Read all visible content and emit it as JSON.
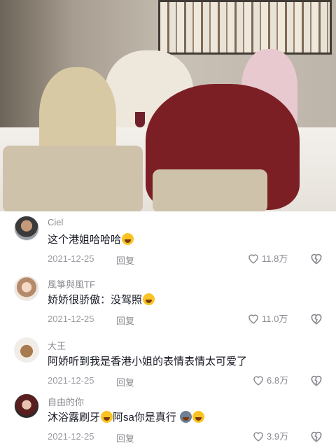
{
  "video": {
    "scene": "dining-room-frame"
  },
  "comments": [
    {
      "username": "Ciel",
      "text": "这个港姐哈哈哈",
      "emoji": "laughing-tears-emoji",
      "date": "2021-12-25",
      "reply": "回复",
      "likes": "11.8万",
      "avatar": "man-glasses-avatar"
    },
    {
      "username": "風箏與風TF",
      "text": "娇娇很骄傲：没驾照",
      "emoji": "laughing-tears-emoji",
      "date": "2021-12-25",
      "reply": "回复",
      "likes": "11.0万",
      "avatar": "anime-girl-avatar"
    },
    {
      "username": "大王",
      "text": "阿娇听到我是香港小姐的表情表情太可爱了",
      "emoji": "",
      "date": "2021-12-25",
      "reply": "回复",
      "likes": "6.8万",
      "avatar": "dog-avatar"
    },
    {
      "username": "自由的你",
      "text_before": "沐浴露刷牙",
      "text_middle": "阿sa你是真行",
      "emoji": "laughing-tears-emoji",
      "emoji2": "cat-face-emoji",
      "date": "2021-12-25",
      "reply": "回复",
      "likes": "3.9万",
      "avatar": "woman-avatar"
    }
  ],
  "colors": {
    "text": "#161823",
    "muted": "#8a8b91",
    "background": "#ffffff"
  }
}
